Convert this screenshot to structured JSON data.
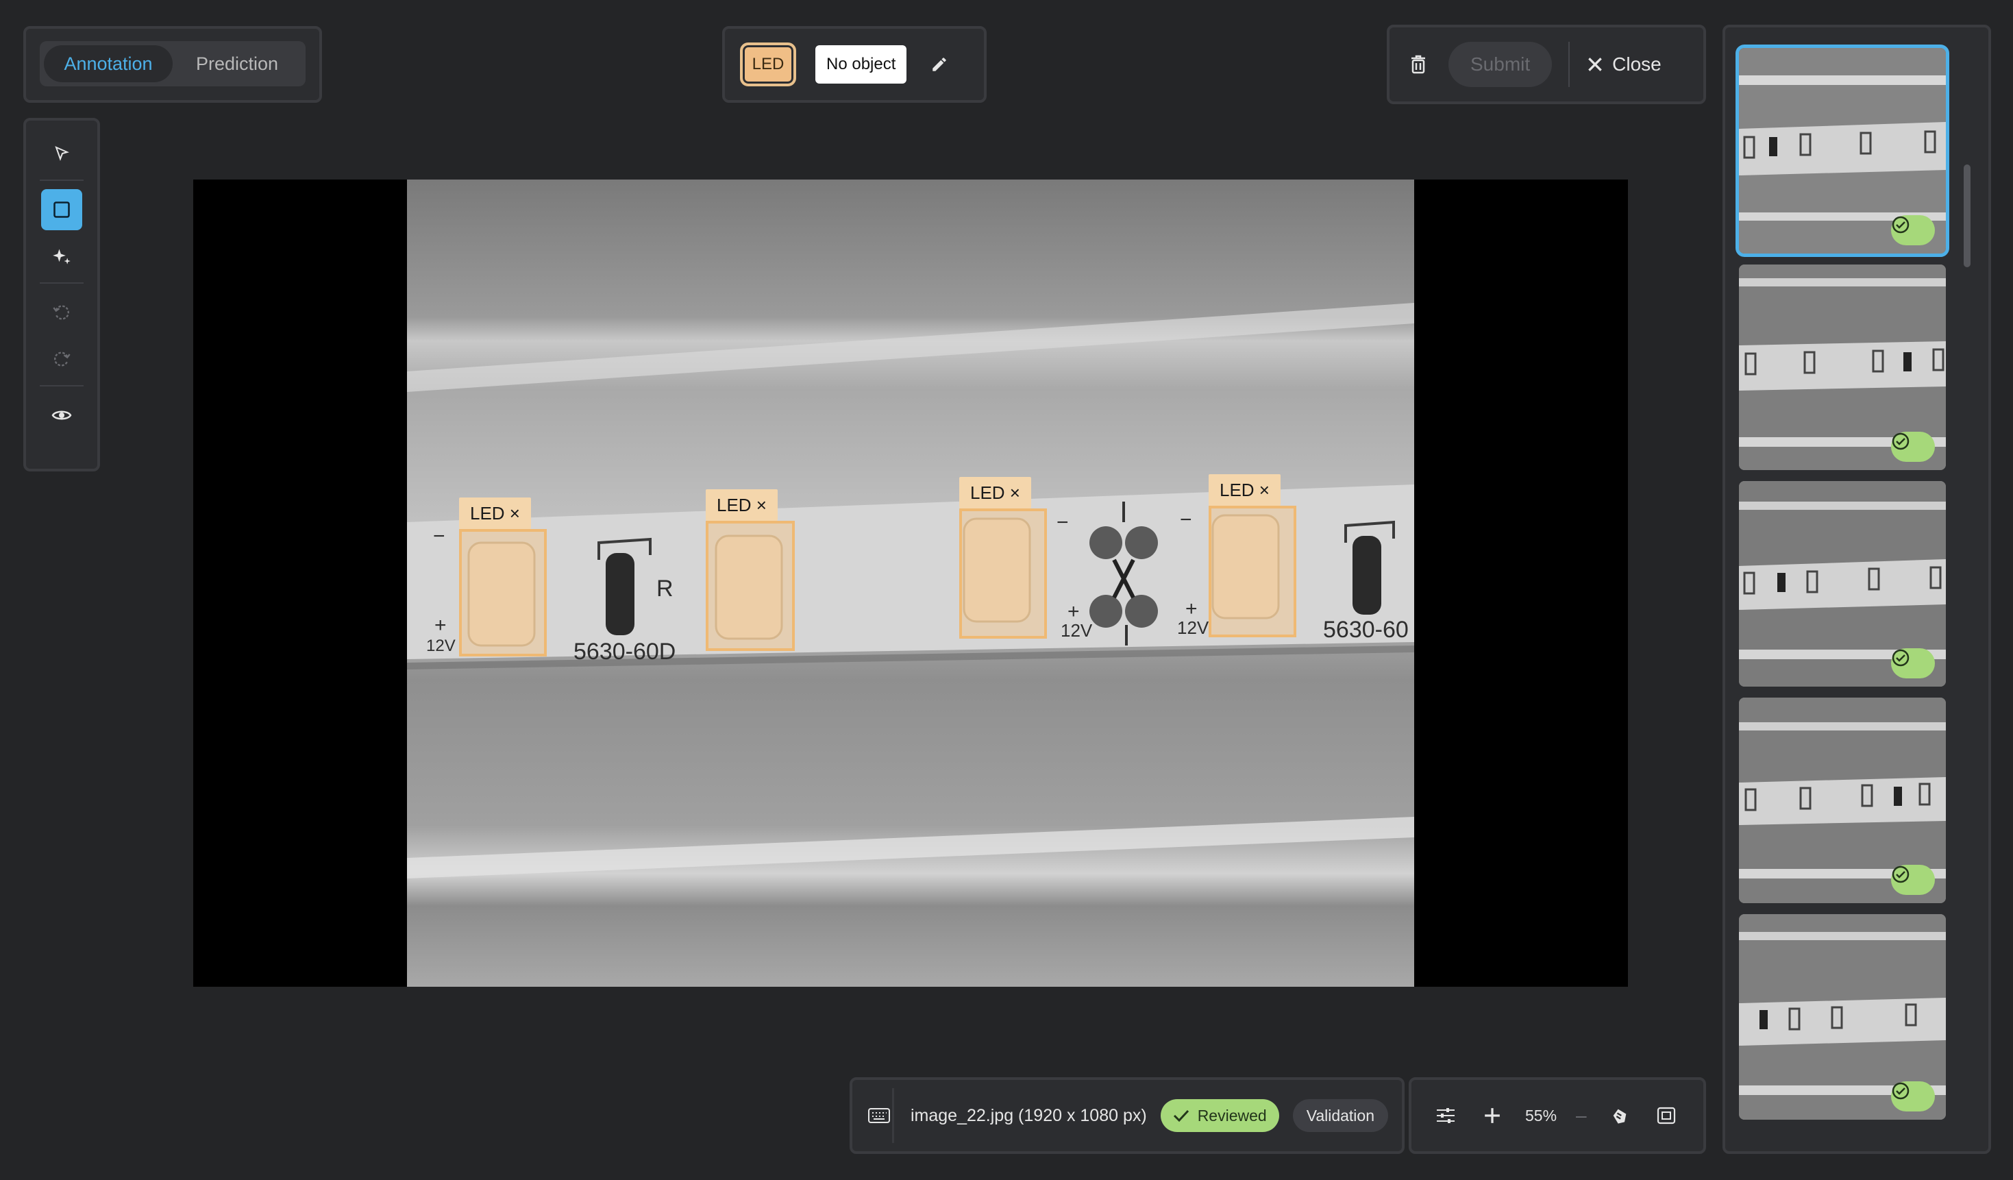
{
  "mode_tabs": {
    "annotation": "Annotation",
    "prediction": "Prediction",
    "active": "annotation"
  },
  "labels": {
    "led": "LED",
    "no_object": "No object"
  },
  "actions": {
    "submit": "Submit",
    "close": "Close"
  },
  "annotations": [
    {
      "label": "LED ×"
    },
    {
      "label": "LED ×"
    },
    {
      "label": "LED ×"
    },
    {
      "label": "LED ×"
    }
  ],
  "status": {
    "file_name": "image_22.jpg (1920 x 1080 px)",
    "reviewed": "Reviewed",
    "validation": "Validation",
    "zoom": "55%"
  },
  "photo_text": {
    "part_code": "5630-60D",
    "part_code_cut": "5630-60",
    "resistor": "R",
    "voltage": "12V",
    "plus": "+",
    "minus": "−"
  },
  "thumbnails": [
    {
      "status": "reviewed",
      "selected": true
    },
    {
      "status": "reviewed",
      "selected": false
    },
    {
      "status": "reviewed",
      "selected": false
    },
    {
      "status": "reviewed",
      "selected": false
    },
    {
      "status": "reviewed",
      "selected": false
    }
  ],
  "colors": {
    "accent": "#4db0e8",
    "label_led": "#f0be86",
    "reviewed": "#a6d87a"
  }
}
